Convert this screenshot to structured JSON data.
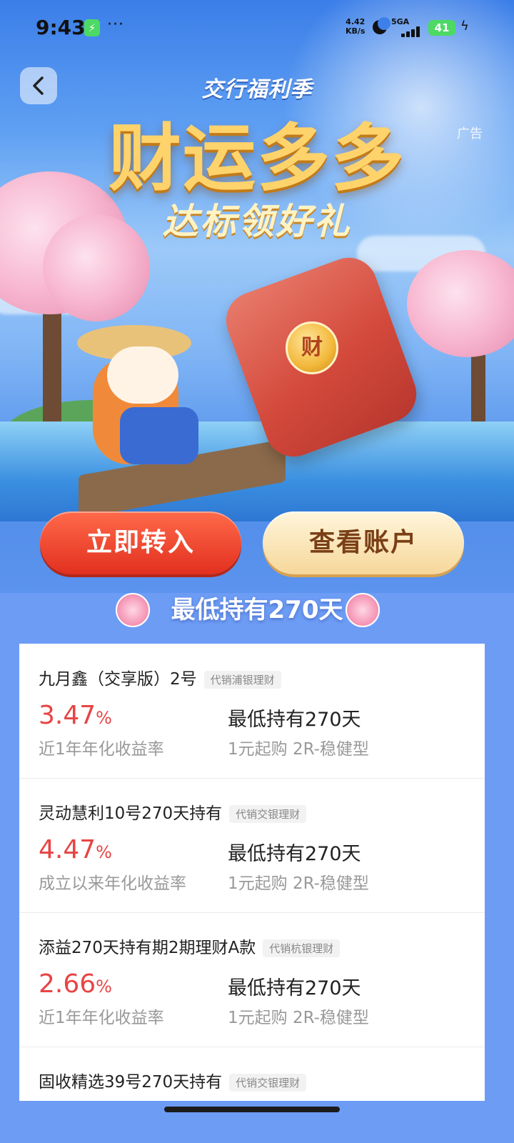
{
  "status_bar": {
    "time": "9:43",
    "dots": "···",
    "net_speed_value": "4.42",
    "net_speed_unit": "KB/s",
    "network": "5GA",
    "battery": "41"
  },
  "header": {
    "back_icon": "chevron-left-icon",
    "brand": "交行福利季",
    "ad_label": "广告"
  },
  "banner": {
    "headline": "财运多多",
    "subheadline": "达标领好礼",
    "coin_text": "财"
  },
  "actions": {
    "primary_label": "立即转入",
    "secondary_label": "查看账户"
  },
  "section_title": "最低持有270天",
  "products": [
    {
      "name": "九月鑫（交享版）2号",
      "tag": "代销浦银理财",
      "rate_value": "3.47",
      "rate_unit": "%",
      "rate_label": "近1年年化收益率",
      "hold": "最低持有270天",
      "meta": "1元起购 2R-稳健型"
    },
    {
      "name": "灵动慧利10号270天持有",
      "tag": "代销交银理财",
      "rate_value": "4.47",
      "rate_unit": "%",
      "rate_label": "成立以来年化收益率",
      "hold": "最低持有270天",
      "meta": "1元起购 2R-稳健型"
    },
    {
      "name": "添益270天持有期2期理财A款",
      "tag": "代销杭银理财",
      "rate_value": "2.66",
      "rate_unit": "%",
      "rate_label": "近1年年化收益率",
      "hold": "最低持有270天",
      "meta": "1元起购 2R-稳健型"
    },
    {
      "name": "固收精选39号270天持有",
      "tag": "代销交银理财"
    }
  ],
  "colors": {
    "accent_red": "#e84444",
    "primary_button": "#e2301f",
    "secondary_button": "#f6d79a",
    "background_blue": "#6d9cf5"
  }
}
